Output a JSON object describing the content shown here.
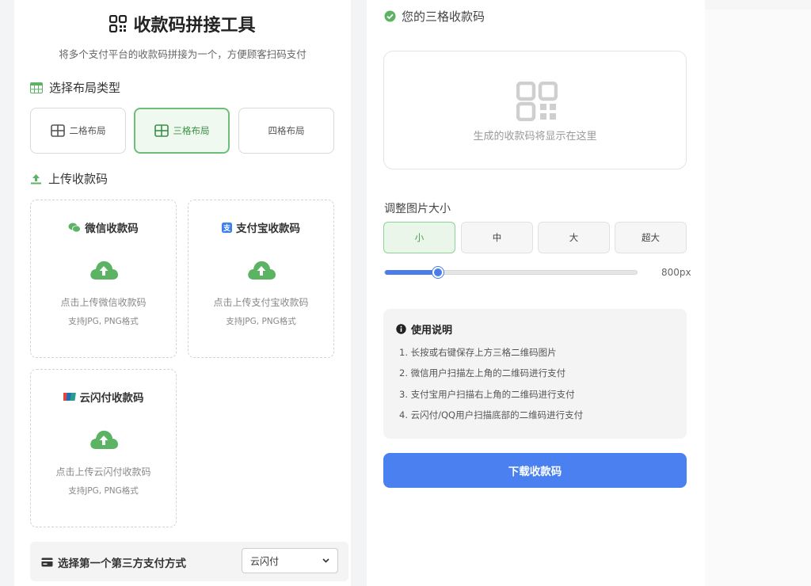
{
  "header": {
    "title": "收款码拼接工具",
    "subtitle": "将多个支付平台的收款码拼接为一个，方便顾客扫码支付"
  },
  "layout_section": {
    "heading": "选择布局类型",
    "options": [
      {
        "label": "二格布局",
        "active": false
      },
      {
        "label": "三格布局",
        "active": true
      },
      {
        "label": "四格布局",
        "active": false
      }
    ]
  },
  "upload_section": {
    "heading": "上传收款码",
    "cards": [
      {
        "title": "微信收款码",
        "hint": "点击上传微信收款码",
        "format": "支持JPG, PNG格式",
        "icon": "wechat-icon"
      },
      {
        "title": "支付宝收款码",
        "hint": "点击上传支付宝收款码",
        "format": "支持JPG, PNG格式",
        "icon": "alipay-icon"
      },
      {
        "title": "云闪付收款码",
        "hint": "点击上传云闪付收款码",
        "format": "支持JPG, PNG格式",
        "icon": "unionpay-icon"
      }
    ]
  },
  "third_party": {
    "label": "选择第一个第三方支付方式",
    "selected": "云闪付"
  },
  "result": {
    "heading": "您的三格收款码",
    "placeholder": "生成的收款码将显示在这里"
  },
  "size": {
    "label": "调整图片大小",
    "options": [
      "小",
      "中",
      "大",
      "超大"
    ],
    "active_index": 0,
    "slider_fraction": 0.21,
    "value_text": "800px"
  },
  "instructions": {
    "title": "使用说明",
    "items": [
      "1. 长按或右键保存上方三格二维码图片",
      "2. 微信用户扫描左上角的二维码进行支付",
      "3. 支付宝用户扫描右上角的二维码进行支付",
      "4. 云闪付/QQ用户扫描底部的二维码进行支付"
    ]
  },
  "download_label": "下载收款码",
  "colors": {
    "accent_green": "#6fbe77",
    "accent_blue": "#4a80f0"
  }
}
